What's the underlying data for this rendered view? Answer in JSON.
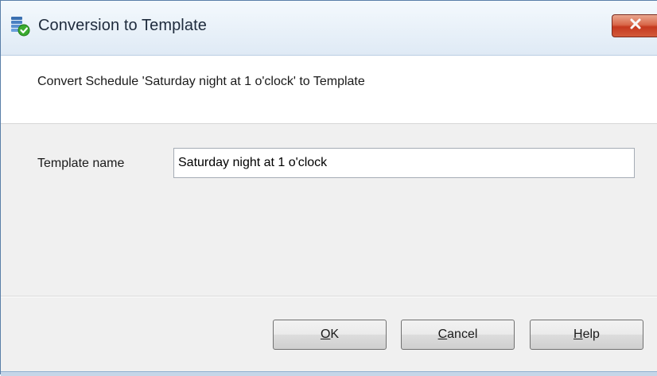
{
  "window": {
    "title": "Conversion to Template",
    "icon": "schedule-template-icon",
    "close_icon": "close-x-icon",
    "close_color": "#c5391f"
  },
  "header": {
    "description": "Convert Schedule 'Saturday night at 1 o'clock' to Template"
  },
  "form": {
    "template_name_label": "Template name",
    "template_name_value": "Saturday night at 1 o'clock"
  },
  "buttons": {
    "ok": {
      "mnemonic": "O",
      "rest": "K"
    },
    "cancel": {
      "mnemonic": "C",
      "rest": "ancel"
    },
    "help": {
      "mnemonic": "H",
      "rest": "elp"
    }
  }
}
